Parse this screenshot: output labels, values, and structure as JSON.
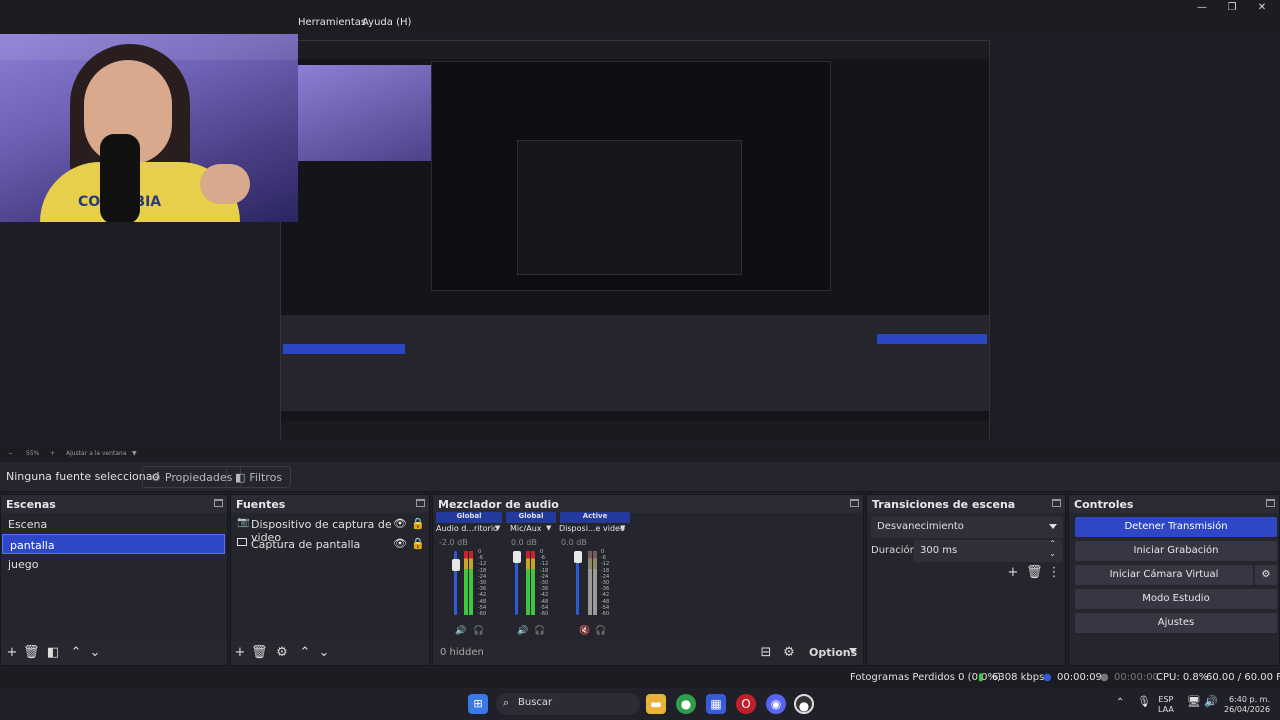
{
  "menu": {
    "tools": "Herramientas",
    "help": "Ayuda (H)"
  },
  "window_controls": {
    "minimize": "—",
    "maximize": "❐",
    "close": "✕"
  },
  "webcam": {
    "shirt_text": "COLOMBIA"
  },
  "zoom": {
    "level": "55%",
    "fit_label": "Ajustar a la ventana"
  },
  "source_toolbar": {
    "no_source": "Ninguna fuente seleccionad",
    "properties": "Propiedades",
    "filters": "Filtros"
  },
  "scenes": {
    "title": "Escenas",
    "items": [
      {
        "label": "Escena",
        "selected": false
      },
      {
        "label": "pantalla",
        "selected": true
      },
      {
        "label": "juego",
        "selected": false
      }
    ]
  },
  "sources": {
    "title": "Fuentes",
    "items": [
      {
        "label": "Dispositivo de captura de video",
        "icon": "camera-icon"
      },
      {
        "label": "Captura de pantalla",
        "icon": "monitor-icon"
      }
    ]
  },
  "mixer": {
    "title": "Mezclador de audio",
    "channels": [
      {
        "badge": "Global",
        "name": "Audio d...ritorio",
        "db": "-2.0 dB",
        "level": 0.78,
        "muted": false
      },
      {
        "badge": "Global",
        "name": "Mic/Aux",
        "db": "0.0 dB",
        "level": 0.76,
        "muted": false
      },
      {
        "badge": "Active",
        "name": "Disposi...e video",
        "db": "0.0 dB",
        "level": 0.6,
        "muted": true
      }
    ],
    "scale": [
      "0",
      "-6",
      "-12",
      "-18",
      "-24",
      "-30",
      "-36",
      "-42",
      "-48",
      "-54",
      "-60"
    ],
    "hidden_label": "0 hidden",
    "options_label": "Options"
  },
  "transitions": {
    "title": "Transiciones de escena",
    "selected": "Desvanecimiento",
    "duration_label": "Duración",
    "duration_value": "300 ms"
  },
  "controls": {
    "title": "Controles",
    "stop_stream": "Detener Transmisión",
    "start_recording": "Iniciar Grabación",
    "virtual_cam": "Iniciar Cámara Virtual",
    "studio_mode": "Modo Estudio",
    "settings": "Ajustes"
  },
  "status": {
    "dropped_frames": "Fotogramas Perdidos 0 (0.0%)",
    "bitrate": "6308 kbps",
    "stream_time": "00:00:09",
    "record_time": "00:00:00",
    "cpu": "CPU: 0.8%",
    "fps": "60.00 / 60.00 FPS"
  },
  "taskbar": {
    "search_placeholder": "Buscar",
    "lang_top": "ESP",
    "lang_bottom": "LAA",
    "time": "6:40 p. m.",
    "date": "26/04/2026"
  },
  "colors": {
    "accent": "#2d47c7",
    "panel": "#24252d",
    "meter_green": "#3ec83e",
    "meter_red": "#c8222c"
  }
}
